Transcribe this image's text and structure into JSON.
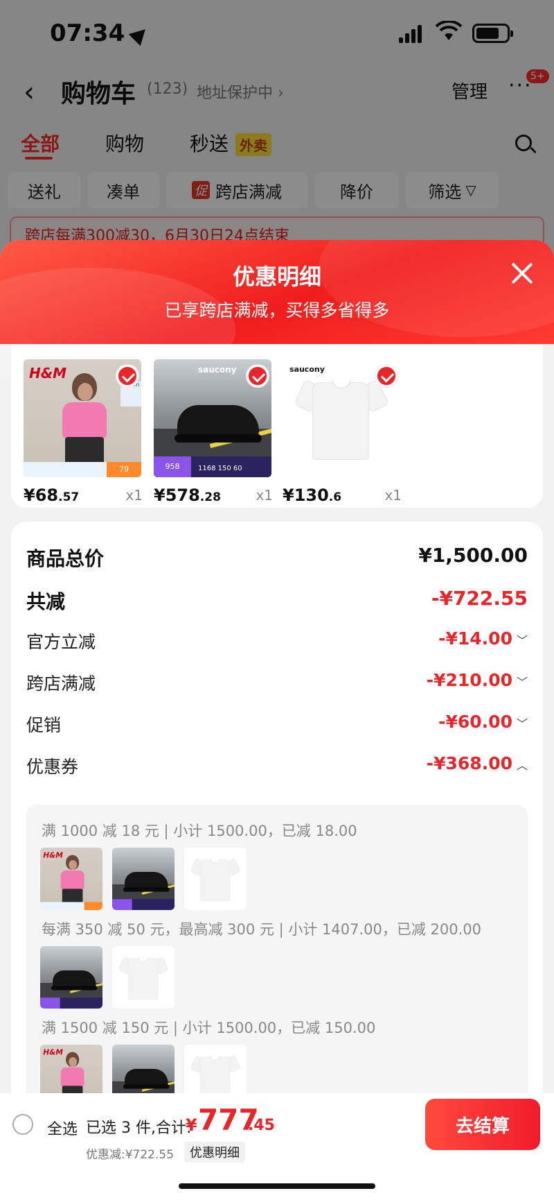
{
  "status": {
    "time": "07:34"
  },
  "nav": {
    "title": "购物车",
    "count": "(123)",
    "address": "地址保护中 ›",
    "manage": "管理",
    "more": "···",
    "badge": "5+"
  },
  "tabs": [
    {
      "label": "全部"
    },
    {
      "label": "购物"
    },
    {
      "label": "秒送"
    }
  ],
  "tab_tag": "外卖",
  "chips": [
    "送礼",
    "凑单",
    "跨店满减",
    "降价",
    "筛选"
  ],
  "chip_promo_tag": "促",
  "promo_strip": "跨店每满300减30，6月30日24点结束",
  "sheet": {
    "title": "优惠明细",
    "subtitle": "已享跨店满减，买得多省得多"
  },
  "products": [
    {
      "price_int": "¥68",
      "price_dec": ".57",
      "qty": "x1",
      "thumb_text": {
        "logo": "H&M",
        "tag": "170cm",
        "badge": "79"
      }
    },
    {
      "price_int": "¥578",
      "price_dec": ".28",
      "qty": "x1",
      "thumb_text": {
        "brand": "saucony",
        "badge": "958",
        "stats": "1168 150 60"
      }
    },
    {
      "price_int": "¥130",
      "price_dec": ".6",
      "qty": "x1",
      "thumb_text": {
        "brand": "saucony"
      }
    }
  ],
  "summary": {
    "total_label": "商品总价",
    "total_value": "¥1,500.00",
    "reduce_label": "共减",
    "reduce_value": "-¥722.55",
    "items": [
      {
        "label": "官方立减",
        "value": "-¥14.00",
        "chevron": "﹀"
      },
      {
        "label": "跨店满减",
        "value": "-¥210.00",
        "chevron": "﹀"
      },
      {
        "label": "促销",
        "value": "-¥60.00",
        "chevron": "﹀"
      },
      {
        "label": "优惠券",
        "value": "-¥368.00",
        "chevron": "︿"
      }
    ]
  },
  "coupons": [
    {
      "text": "满 1000 减 18 元 | 小计 1500.00，已减 18.00"
    },
    {
      "text": "每满 350 减 50 元，最高减 300 元 | 小计 1407.00，已减 200.00"
    },
    {
      "text": "满 1500 减 150 元 | 小计 1500.00，已减 150.00"
    }
  ],
  "bottom": {
    "select_all": "全选",
    "selected": "已选 3 件,合计:",
    "yen": "¥",
    "total_int": "777",
    "total_dec": ".45",
    "discount": "优惠减:¥722.55",
    "detail": "优惠明细",
    "checkout": "去结算"
  },
  "colors": {
    "accent": "#e8262a",
    "header_start": "#ff5a45",
    "header_end": "#f01d1d"
  }
}
